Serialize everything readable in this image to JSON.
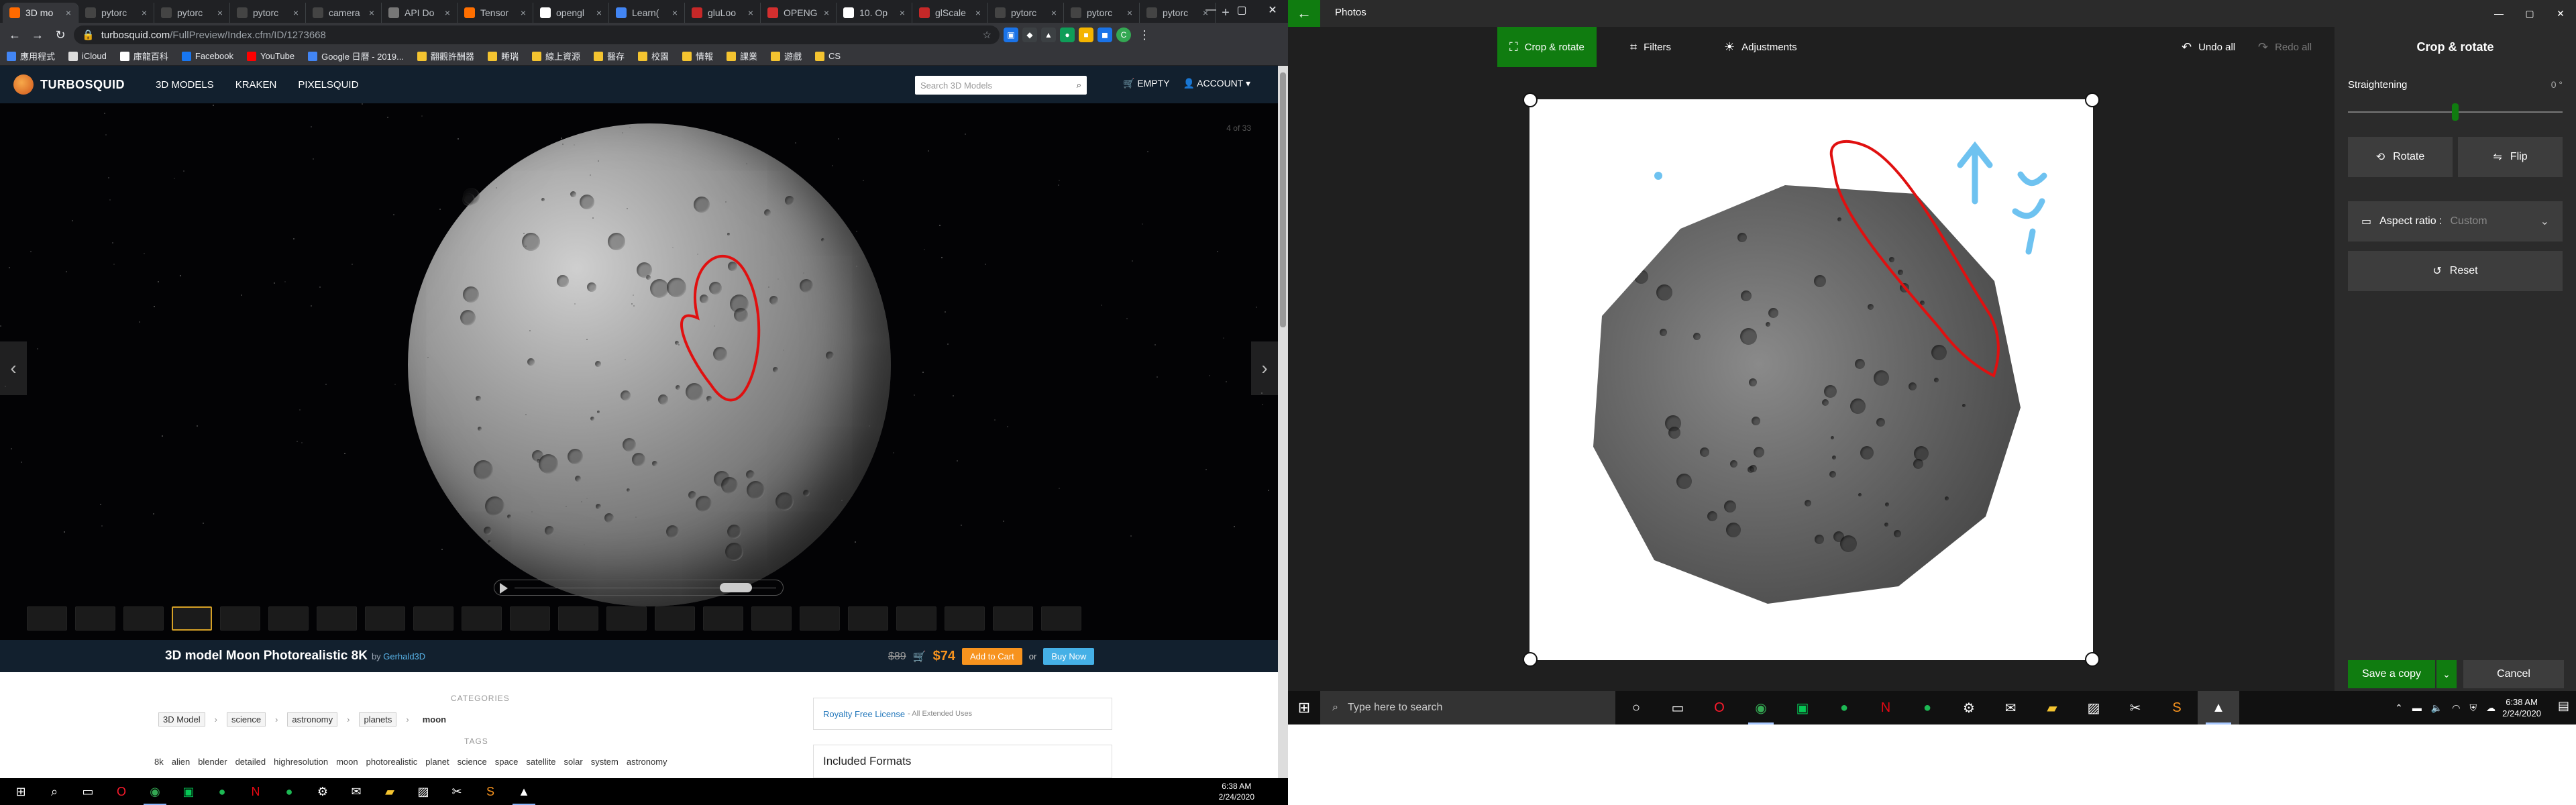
{
  "chrome": {
    "tabs": [
      {
        "label": "3D mo",
        "color": "#ff6a00",
        "active": true
      },
      {
        "label": "pytorc",
        "color": "#444444",
        "active": false
      },
      {
        "label": "pytorc",
        "color": "#444444",
        "active": false
      },
      {
        "label": "pytorc",
        "color": "#444444",
        "active": false
      },
      {
        "label": "camera",
        "color": "#444444",
        "active": false
      },
      {
        "label": "API Do",
        "color": "#777777",
        "active": false
      },
      {
        "label": "Tensor",
        "color": "#ff6f00",
        "active": false
      },
      {
        "label": "opengl",
        "color": "#ffffff",
        "active": false
      },
      {
        "label": "Learn(",
        "color": "#4285f4",
        "active": false
      },
      {
        "label": "gluLoo",
        "color": "#c62828",
        "active": false
      },
      {
        "label": "OPENG",
        "color": "#d32f2f",
        "active": false
      },
      {
        "label": "10. Op",
        "color": "#ffffff",
        "active": false
      },
      {
        "label": "glScale",
        "color": "#c62828",
        "active": false
      },
      {
        "label": "pytorc",
        "color": "#444444",
        "active": false
      },
      {
        "label": "pytorc",
        "color": "#444444",
        "active": false
      },
      {
        "label": "pytorc",
        "color": "#444444",
        "active": false
      }
    ],
    "tab_close": "×",
    "new_tab": "+",
    "window_controls": [
      "—",
      "▢",
      "✕"
    ],
    "url_host": "turbosquid.com",
    "url_path": "/FullPreview/Index.cfm/ID/1273668",
    "bookmarks": [
      {
        "label": "應用程式",
        "color": "#4285f4"
      },
      {
        "label": "iCloud",
        "color": "#dddddd"
      },
      {
        "label": "庫龍百科",
        "color": "#ffffff"
      },
      {
        "label": "Facebook",
        "color": "#1877f2"
      },
      {
        "label": "YouTube",
        "color": "#ff0000"
      },
      {
        "label": "Google 日曆 - 2019...",
        "color": "#4285f4"
      },
      {
        "label": "翻觀許酬器",
        "color": "#f4c430"
      },
      {
        "label": "睡瑞",
        "color": "#f4c430"
      },
      {
        "label": "線上資源",
        "color": "#f4c430"
      },
      {
        "label": "醫存",
        "color": "#f4c430"
      },
      {
        "label": "校園",
        "color": "#f4c430"
      },
      {
        "label": "情報",
        "color": "#f4c430"
      },
      {
        "label": "課業",
        "color": "#f4c430"
      },
      {
        "label": "遊戲",
        "color": "#f4c430"
      },
      {
        "label": "CS",
        "color": "#f4c430"
      }
    ]
  },
  "turbosquid": {
    "logo": "TURBOSQUID",
    "nav": [
      "3D MODELS",
      "KRAKEN",
      "PIXELSQUID"
    ],
    "search_placeholder": "Search 3D Models",
    "cart": "EMPTY",
    "account": "ACCOUNT",
    "viewer_count": "4 of 33",
    "title": "3D model Moon Photorealistic 8K",
    "by": "by",
    "author": "Gerhald3D",
    "old_price": "$89",
    "new_price": "$74",
    "add_to_cart": "Add to Cart",
    "or": "or",
    "buy_now": "Buy Now",
    "categories_heading": "CATEGORIES",
    "categories": [
      "3D Model",
      "science",
      "astronomy",
      "planets",
      "moon"
    ],
    "tags_heading": "TAGS",
    "tags": [
      "8k",
      "alien",
      "blender",
      "detailed",
      "highresolution",
      "moon",
      "photorealistic",
      "planet",
      "science",
      "space",
      "satellite",
      "solar",
      "system",
      "astronomy"
    ],
    "license": "Royalty Free License",
    "license_suffix": "- All Extended Uses",
    "formats_heading": "Included Formats"
  },
  "taskbar_left": {
    "time": "6:38 AM",
    "date": "2/24/2020"
  },
  "photos": {
    "app_name": "Photos",
    "tool_crop": "Crop & rotate",
    "tool_filters": "Filters",
    "tool_adjustments": "Adjustments",
    "undo_all": "Undo all",
    "redo_all": "Redo all",
    "panel_title": "Crop & rotate",
    "straightening": "Straightening",
    "straightening_value": "0 °",
    "straightening_level": 0.5,
    "rotate": "Rotate",
    "flip": "Flip",
    "aspect_label": "Aspect ratio :",
    "aspect_value": "Custom",
    "reset": "Reset",
    "save_copy": "Save a copy",
    "cancel": "Cancel"
  },
  "taskbar_right": {
    "search_placeholder": "Type here to search",
    "time": "6:38 AM",
    "date": "2/24/2020"
  },
  "colors": {
    "photos_accent": "#107c10",
    "annotation_red": "#e01010",
    "annotation_blue": "#6ec2f0",
    "turbosquid_orange": "#f7931e",
    "turbosquid_blue": "#45b0e6"
  }
}
